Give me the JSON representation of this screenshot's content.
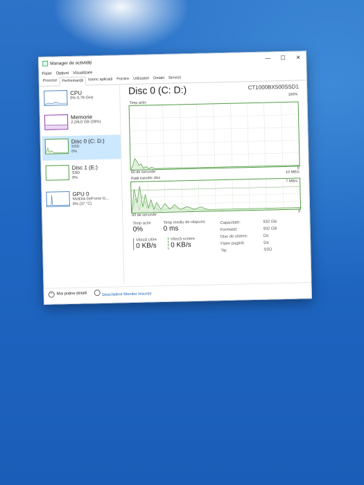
{
  "window": {
    "title": "Manager de activități",
    "menu": [
      "Fișier",
      "Opțiuni",
      "Vizualizare"
    ],
    "tabs": [
      "Procese",
      "Performanță",
      "Istoric aplicații",
      "Pornire",
      "Utilizatori",
      "Detalii",
      "Servicii"
    ],
    "active_tab": "Performanță",
    "controls": {
      "minimize": "—",
      "maximize": "☐",
      "close": "✕"
    }
  },
  "sidebar": {
    "items": [
      {
        "name": "CPU",
        "line1": "0% 0,79 GHz",
        "line2": ""
      },
      {
        "name": "Memorie",
        "line1": "2,2/8,0 GB (28%)",
        "line2": ""
      },
      {
        "name": "Disc 0 (C: D:)",
        "line1": "SSD",
        "line2": "0%"
      },
      {
        "name": "Disc 1 (E:)",
        "line1": "SSD",
        "line2": "0%"
      },
      {
        "name": "GPU 0",
        "line1": "NVIDIA GeForce G...",
        "line2": "0% (37 °C)"
      }
    ],
    "selected_index": 2
  },
  "main": {
    "title": "Disc 0 (C: D:)",
    "model": "CT1000BX500SSD1",
    "active_graph": {
      "label": "Timp activ",
      "max": "100%",
      "min": "0",
      "time": "60 de secunde"
    },
    "transfer_graph": {
      "label": "Rată transfer disc",
      "max": "10 MB/s",
      "marker": "7 MB/s",
      "min": "0",
      "time": "60 de secunde"
    },
    "stats": {
      "active_time_label": "Timp activ",
      "active_time_value": "0%",
      "response_label": "Timp mediu de răspuns",
      "response_value": "0 ms",
      "read_label": "Viteză citire",
      "read_value": "0 KB/s",
      "write_label": "Viteză scriere",
      "write_value": "0 KB/s"
    },
    "properties": [
      {
        "key": "Capacitate:",
        "value": "932 GB"
      },
      {
        "key": "Formatat:",
        "value": "932 GB"
      },
      {
        "key": "Disc de sistem:",
        "value": "Da"
      },
      {
        "key": "Fișier pagină:",
        "value": "Da"
      },
      {
        "key": "Tip:",
        "value": "SSD"
      }
    ]
  },
  "footer": {
    "less_details": "Mai puține detalii",
    "open_monitor": "Deschidere Monitor resurse"
  },
  "colors": {
    "disk_green": "#4f9b43",
    "selected_bg": "#cce8ff",
    "link_blue": "#1a5fb4"
  }
}
